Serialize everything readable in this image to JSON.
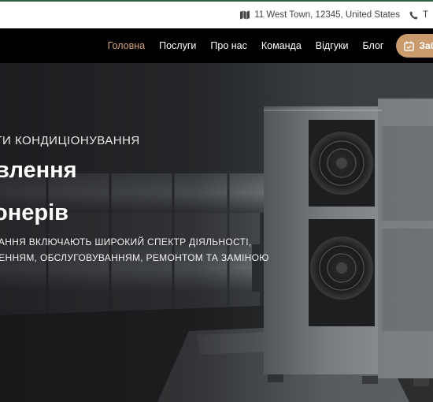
{
  "topbar": {
    "address": "11 West Town, 12345, United States",
    "phone": "T",
    "address_icon": "map-icon",
    "phone_icon": "phone-icon"
  },
  "nav": {
    "items": [
      {
        "label": "Головна",
        "active": true
      },
      {
        "label": "Послуги"
      },
      {
        "label": "Про нас"
      },
      {
        "label": "Команда"
      },
      {
        "label": "Відгуки"
      },
      {
        "label": "Блог"
      }
    ],
    "book_label": "Заброн",
    "book_icon": "calendar-check-icon"
  },
  "hero": {
    "subtitle": "ЛУГИ КОНДИЦІОНУВАННЯ",
    "title_line1": "влення",
    "title_line2": "онерів",
    "desc_line1": "ВАННЯ ВКЛЮЧАЮТЬ ШИРОКИЙ СПЕКТР ДІЯЛЬНОСТІ,",
    "desc_line2": "ЛЕННЯМ, ОБСЛУГОВУВАННЯМ, РЕМОНТОМ ТА ЗАМІНОЮ"
  },
  "colors": {
    "accent": "#c99b6d",
    "active_nav": "#d4a373",
    "nav_bg": "#000000",
    "topbar_bg": "#ffffff"
  }
}
